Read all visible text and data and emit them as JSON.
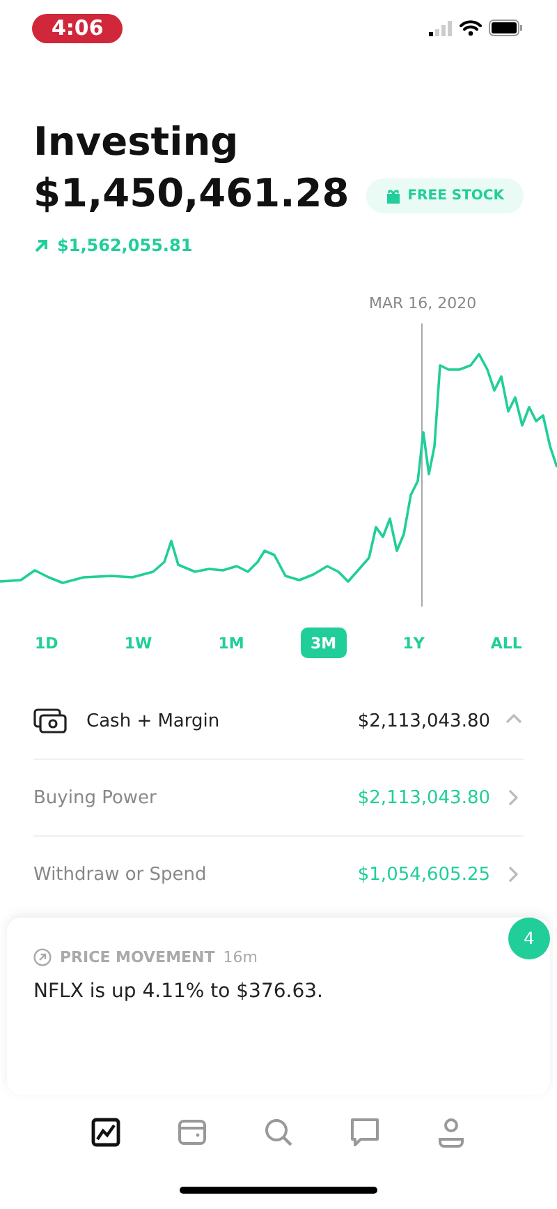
{
  "status_bar": {
    "time": "4:06"
  },
  "header": {
    "title": "Investing",
    "balance": "$1,450,461.28",
    "change": "$1,562,055.81",
    "promo": "FREE STOCK"
  },
  "chart": {
    "date_label": "MAR 16, 2020"
  },
  "ranges": [
    {
      "label": "1D",
      "selected": false
    },
    {
      "label": "1W",
      "selected": false
    },
    {
      "label": "1M",
      "selected": false
    },
    {
      "label": "3M",
      "selected": true
    },
    {
      "label": "1Y",
      "selected": false
    },
    {
      "label": "ALL",
      "selected": false
    }
  ],
  "rows": [
    {
      "kind": "summary",
      "label": "Cash + Margin",
      "value": "$2,113,043.80",
      "expanded": true
    },
    {
      "kind": "detail",
      "label": "Buying Power",
      "value": "$2,113,043.80"
    },
    {
      "kind": "detail",
      "label": "Withdraw or Spend",
      "value": "$1,054,605.25"
    }
  ],
  "card": {
    "category": "PRICE MOVEMENT",
    "time": "16m",
    "message": "NFLX is up 4.11% to $376.63.",
    "badge": "4"
  },
  "nav": [
    {
      "kind": "chart",
      "selected": true
    },
    {
      "kind": "wallet",
      "selected": false
    },
    {
      "kind": "search",
      "selected": false
    },
    {
      "kind": "chat",
      "selected": false
    },
    {
      "kind": "account",
      "selected": false
    }
  ]
}
